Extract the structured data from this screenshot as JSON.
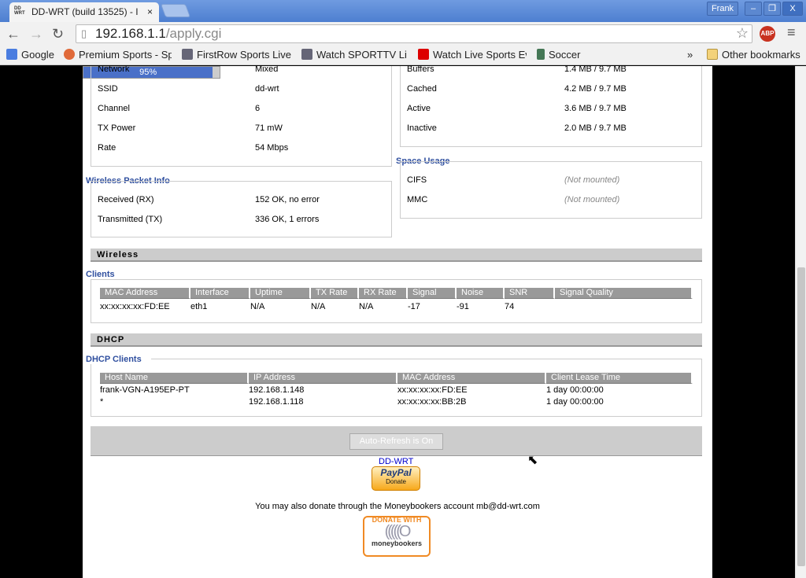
{
  "browser": {
    "tab_title": "DD-WRT (build 13525) - I",
    "user": "Frank",
    "url_host": "192.168.1.1",
    "url_path": "/apply.cgi",
    "bookmarks": [
      "Google",
      "Premium Sports - Spo",
      "FirstRow Sports Live F",
      "Watch SPORTTV Live",
      "Watch Live Sports Eve",
      "Soccer"
    ],
    "overflow": "»",
    "other_bookmarks": "Other bookmarks"
  },
  "wireless_info": [
    {
      "label": "Network",
      "value": "Mixed"
    },
    {
      "label": "SSID",
      "value": "dd-wrt"
    },
    {
      "label": "Channel",
      "value": "6"
    },
    {
      "label": "TX Power",
      "value": "71 mW"
    },
    {
      "label": "Rate",
      "value": "54 Mbps"
    }
  ],
  "memory": [
    {
      "label": "Buffers",
      "value": "1.4 MB / 9.7 MB"
    },
    {
      "label": "Cached",
      "value": "4.2 MB / 9.7 MB"
    },
    {
      "label": "Active",
      "value": "3.6 MB / 9.7 MB"
    },
    {
      "label": "Inactive",
      "value": "2.0 MB / 9.7 MB"
    }
  ],
  "packet": {
    "title": "Wireless Packet Info",
    "rows": [
      {
        "label": "Received (RX)",
        "value": "152 OK, no error"
      },
      {
        "label": "Transmitted (TX)",
        "value": "336 OK, 1 errors"
      }
    ]
  },
  "space": {
    "title": "Space Usage",
    "rows": [
      {
        "label": "CIFS",
        "value": "(Not mounted)"
      },
      {
        "label": "MMC",
        "value": "(Not mounted)"
      }
    ]
  },
  "wireless": {
    "section": "Wireless",
    "clients_title": "Clients",
    "headers": [
      "MAC Address",
      "Interface",
      "Uptime",
      "TX Rate",
      "RX Rate",
      "Signal",
      "Noise",
      "SNR",
      "Signal Quality"
    ],
    "row": [
      "xx:xx:xx:xx:FD:EE",
      "eth1",
      "N/A",
      "N/A",
      "N/A",
      "-17",
      "-91",
      "74"
    ],
    "quality_label": "95%",
    "quality_percent": 95
  },
  "dhcp": {
    "section": "DHCP",
    "clients_title": "DHCP Clients",
    "headers": [
      "Host Name",
      "IP Address",
      "MAC Address",
      "Client Lease Time"
    ],
    "rows": [
      [
        "frank-VGN-A195EP-PT",
        "192.168.1.148",
        "xx:xx:xx:xx:FD:EE",
        "1 day 00:00:00"
      ],
      [
        "*",
        "192.168.1.118",
        "xx:xx:xx:xx:BB:2B",
        "1 day 00:00:00"
      ]
    ]
  },
  "footer": {
    "refresh": "Auto-Refresh is On",
    "link": "DD-WRT",
    "paypal": "PayPal",
    "paypal_donate": "Donate",
    "moneybookers_text": "You may also donate through the Moneybookers account mb@dd-wrt.com",
    "mb_top": "DONATE WITH",
    "mb_bottom": "moneybookers"
  }
}
